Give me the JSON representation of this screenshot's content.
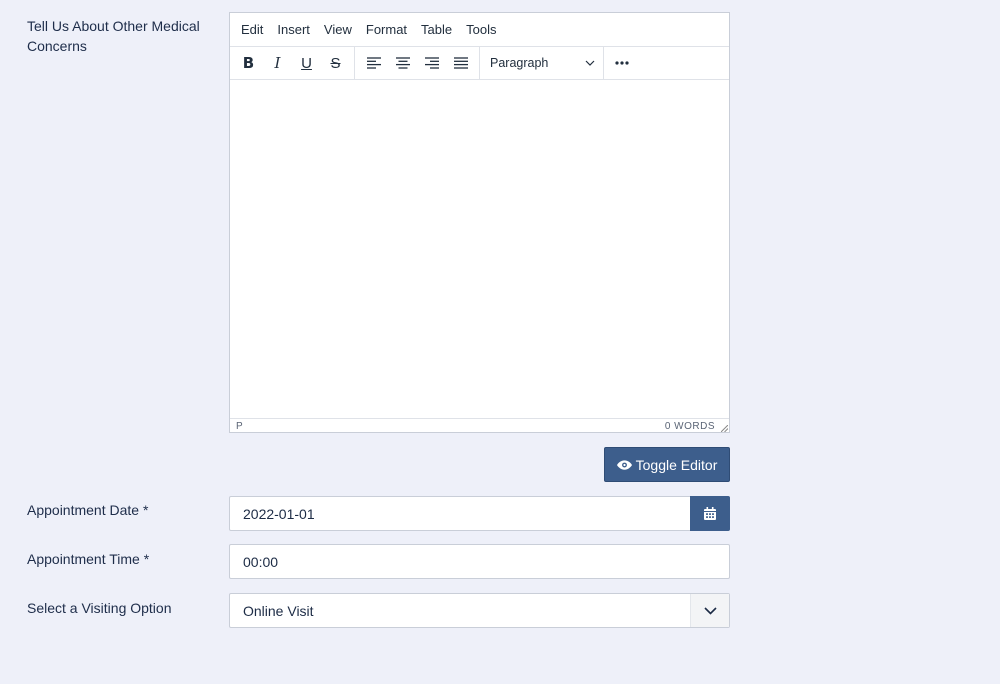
{
  "form": {
    "medical_label": "Tell Us About Other Medical Concerns",
    "date_label": "Appointment Date *",
    "time_label": "Appointment Time *",
    "visit_label": "Select a Visiting Option"
  },
  "editor": {
    "menu": [
      "Edit",
      "Insert",
      "View",
      "Format",
      "Table",
      "Tools"
    ],
    "toolbar": {
      "bold": "B",
      "italic": "I",
      "underline": "U",
      "strikethrough": "S",
      "block_format": "Paragraph",
      "icons": [
        "bold-icon",
        "italic-icon",
        "underline-icon",
        "strikethrough-icon",
        "align-left-icon",
        "align-center-icon",
        "align-right-icon",
        "align-justify-icon",
        "chevron-down-icon",
        "more-icon"
      ]
    },
    "status_path": "P",
    "word_count": "0 WORDS"
  },
  "toggle_button": {
    "label": "Toggle Editor",
    "icon": "eye-icon"
  },
  "appointment_date": {
    "value": "2022-01-01",
    "icon": "calendar-icon"
  },
  "appointment_time": {
    "value": "00:00"
  },
  "visiting_option": {
    "selected": "Online Visit",
    "icon": "chevron-down-icon"
  },
  "colors": {
    "background": "#eef0f9",
    "primary": "#3d5e8c",
    "text": "#1c2b45",
    "border": "#c9ced8"
  }
}
